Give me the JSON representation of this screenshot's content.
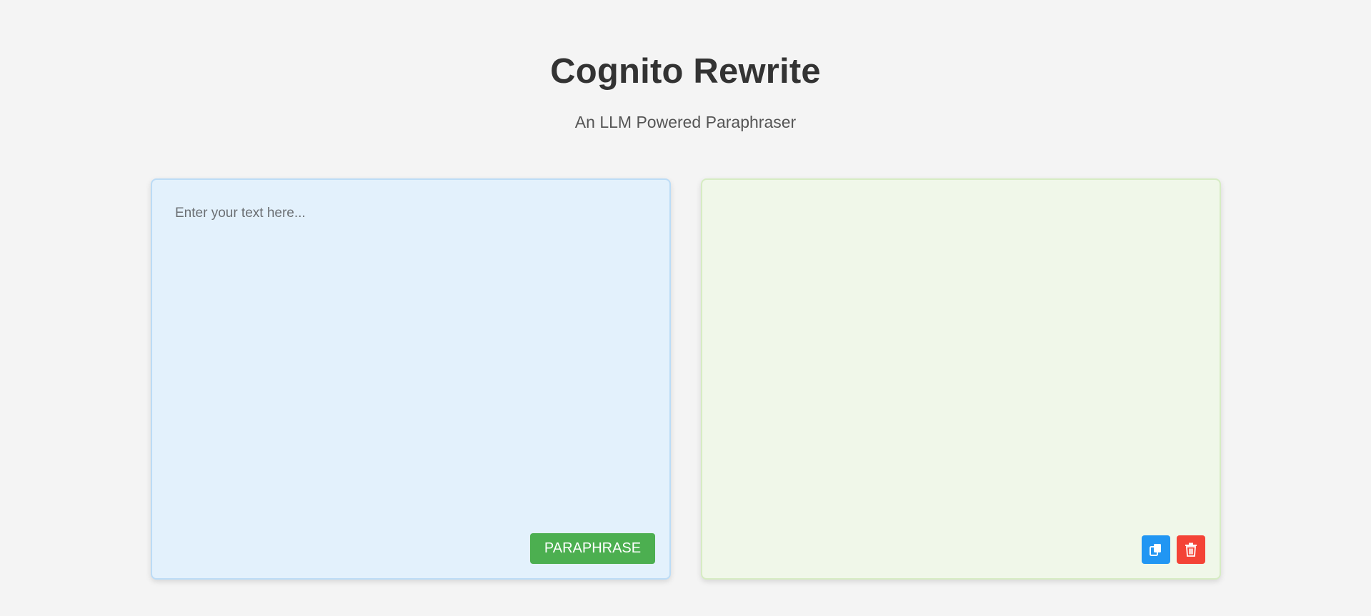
{
  "header": {
    "title": "Cognito Rewrite",
    "subtitle": "An LLM Powered Paraphraser"
  },
  "input_panel": {
    "placeholder": "Enter your text here...",
    "value": "",
    "paraphrase_label": "PARAPHRASE"
  },
  "output_panel": {
    "text": "",
    "copy_icon": "copy-icon",
    "delete_icon": "trash-icon"
  },
  "colors": {
    "background": "#f4f4f4",
    "input_panel_bg": "#e3f1fc",
    "output_panel_bg": "#f0f7e9",
    "paraphrase_button": "#4caf50",
    "copy_button": "#2196f3",
    "delete_button": "#f44336"
  }
}
